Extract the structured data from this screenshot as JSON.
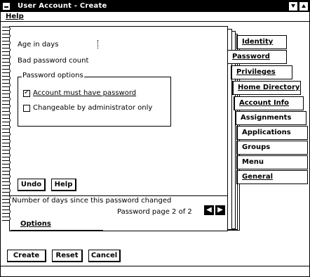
{
  "window": {
    "title": "User Account - Create"
  },
  "menubar": {
    "help": "Help"
  },
  "fields": {
    "age_label": "Age in days",
    "bad_password_label": "Bad password count"
  },
  "password_options": {
    "title": "Password options",
    "must_have": {
      "label": "Account must have password",
      "checked": true
    },
    "changeable": {
      "label": "Changeable by administrator only",
      "checked": false
    }
  },
  "page_buttons": {
    "undo": "Undo",
    "help": "Help"
  },
  "status": {
    "description": "Number of days since this password changed",
    "page_indicator": "Password page 2 of 2"
  },
  "tabs": {
    "identity": "Identity",
    "password": "Password",
    "privileges": "Privileges",
    "home_directory": "Home Directory",
    "account_info": "Account Info",
    "assignments": "Assignments",
    "applications": "Applications",
    "groups": "Groups",
    "menu": "Menu",
    "general": "General",
    "options": "Options"
  },
  "dialog_buttons": {
    "create": "Create",
    "reset": "Reset",
    "cancel": "Cancel"
  }
}
